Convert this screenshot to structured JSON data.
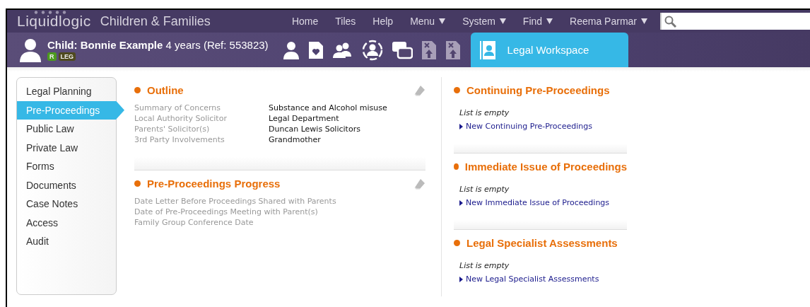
{
  "app": {
    "logo": "Liquidlogic",
    "title": "Children & Families"
  },
  "nav": [
    {
      "label": "Home",
      "dropdown": false
    },
    {
      "label": "Tiles",
      "dropdown": false
    },
    {
      "label": "Help",
      "dropdown": false
    },
    {
      "label": "Menu",
      "dropdown": true
    },
    {
      "label": "System",
      "dropdown": true
    },
    {
      "label": "Find",
      "dropdown": true
    },
    {
      "label": "Reema Parmar",
      "dropdown": true
    }
  ],
  "subject": {
    "name": "Child: Bonnie Example",
    "details": "4 years (Ref: 553823)",
    "badges": [
      {
        "label": "R",
        "color": "#4c9a1e"
      },
      {
        "label": "LEG",
        "color": "#4f4a1f"
      }
    ]
  },
  "toolbar": [
    {
      "kind": "person",
      "disabled": false
    },
    {
      "kind": "document-heart",
      "disabled": false
    },
    {
      "kind": "people",
      "disabled": false
    },
    {
      "kind": "person-circle",
      "disabled": false
    },
    {
      "kind": "windows",
      "disabled": false
    },
    {
      "kind": "upload-doc",
      "disabled": true
    },
    {
      "kind": "upload-doc",
      "disabled": true
    }
  ],
  "workspace_tab": {
    "label": "Legal Workspace",
    "selected": true
  },
  "sidebar": {
    "items": [
      {
        "label": "Legal Planning",
        "selected": false
      },
      {
        "label": "Pre-Proceedings",
        "selected": true
      },
      {
        "label": "Public Law",
        "selected": false
      },
      {
        "label": "Private Law",
        "selected": false
      },
      {
        "label": "Forms",
        "selected": false
      },
      {
        "label": "Documents",
        "selected": false
      },
      {
        "label": "Case Notes",
        "selected": false
      },
      {
        "label": "Access",
        "selected": false
      },
      {
        "label": "Audit",
        "selected": false
      }
    ]
  },
  "sections": [
    {
      "title": "Outline",
      "fields": [
        {
          "label": "Summary of Concerns",
          "value": "Substance and Alcohol misuse"
        },
        {
          "label": "Local Authority Solicitor",
          "value": "Legal Department"
        },
        {
          "label": "Parents' Solicitor(s)",
          "value": "Duncan Lewis Solicitors"
        },
        {
          "label": "3rd Party Involvements",
          "value": "Grandmother"
        }
      ]
    },
    {
      "title": "Pre-Proceedings Progress",
      "fields": [
        {
          "label": "Date Letter Before Proceedings Shared with Parents"
        },
        {
          "label": "Date of Pre-Proceedings Meeting with Parent(s)"
        },
        {
          "label": "Family Group Conference Date"
        }
      ]
    }
  ],
  "lists": [
    {
      "title": "Continuing Pre-Proceedings",
      "empty_text": "List is empty",
      "link": "New Continuing Pre-Proceedings"
    },
    {
      "title": "Immediate Issue of Proceedings",
      "empty_text": "List is empty",
      "link": "New Immediate Issue of Proceedings"
    },
    {
      "title": "Legal Specialist Assessments",
      "empty_text": "List is empty",
      "link": "New Legal Specialist Assessments"
    }
  ]
}
